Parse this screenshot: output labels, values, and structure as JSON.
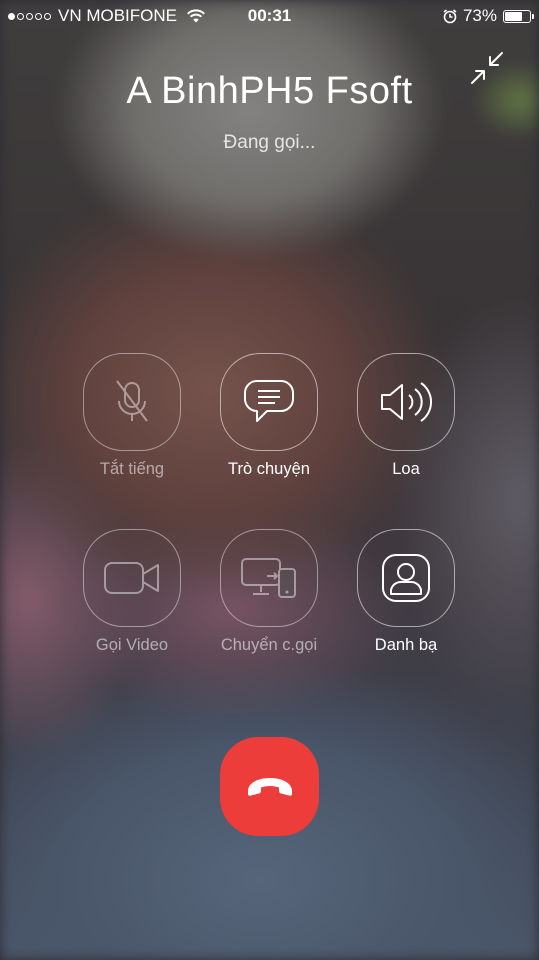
{
  "status_bar": {
    "carrier": "VN MOBIFONE",
    "signal_bars_filled": 1,
    "signal_bars_total": 5,
    "time": "00:31",
    "battery_percent": "73%",
    "battery_level": 0.73,
    "icons": [
      "signal-dots-icon",
      "wifi-icon",
      "alarm-icon",
      "battery-icon"
    ]
  },
  "call": {
    "contact_name": "A BinhPH5 Fsoft",
    "status": "Đang gọi..."
  },
  "actions": [
    {
      "label": "Tắt tiếng",
      "icon": "mic-muted-icon",
      "enabled": false
    },
    {
      "label": "Trò chuyện",
      "icon": "chat-bubble-icon",
      "enabled": true
    },
    {
      "label": "Loa",
      "icon": "speaker-icon",
      "enabled": true
    },
    {
      "label": "Gọi Video",
      "icon": "video-camera-icon",
      "enabled": false
    },
    {
      "label": "Chuyển c.gọi",
      "icon": "transfer-call-icon",
      "enabled": false
    },
    {
      "label": "Danh bạ",
      "icon": "contact-icon",
      "enabled": true
    }
  ],
  "controls": {
    "minimize_icon": "minimize-arrows-icon",
    "end_call_icon": "end-call-icon",
    "end_call_color": "#ec3d3a"
  }
}
